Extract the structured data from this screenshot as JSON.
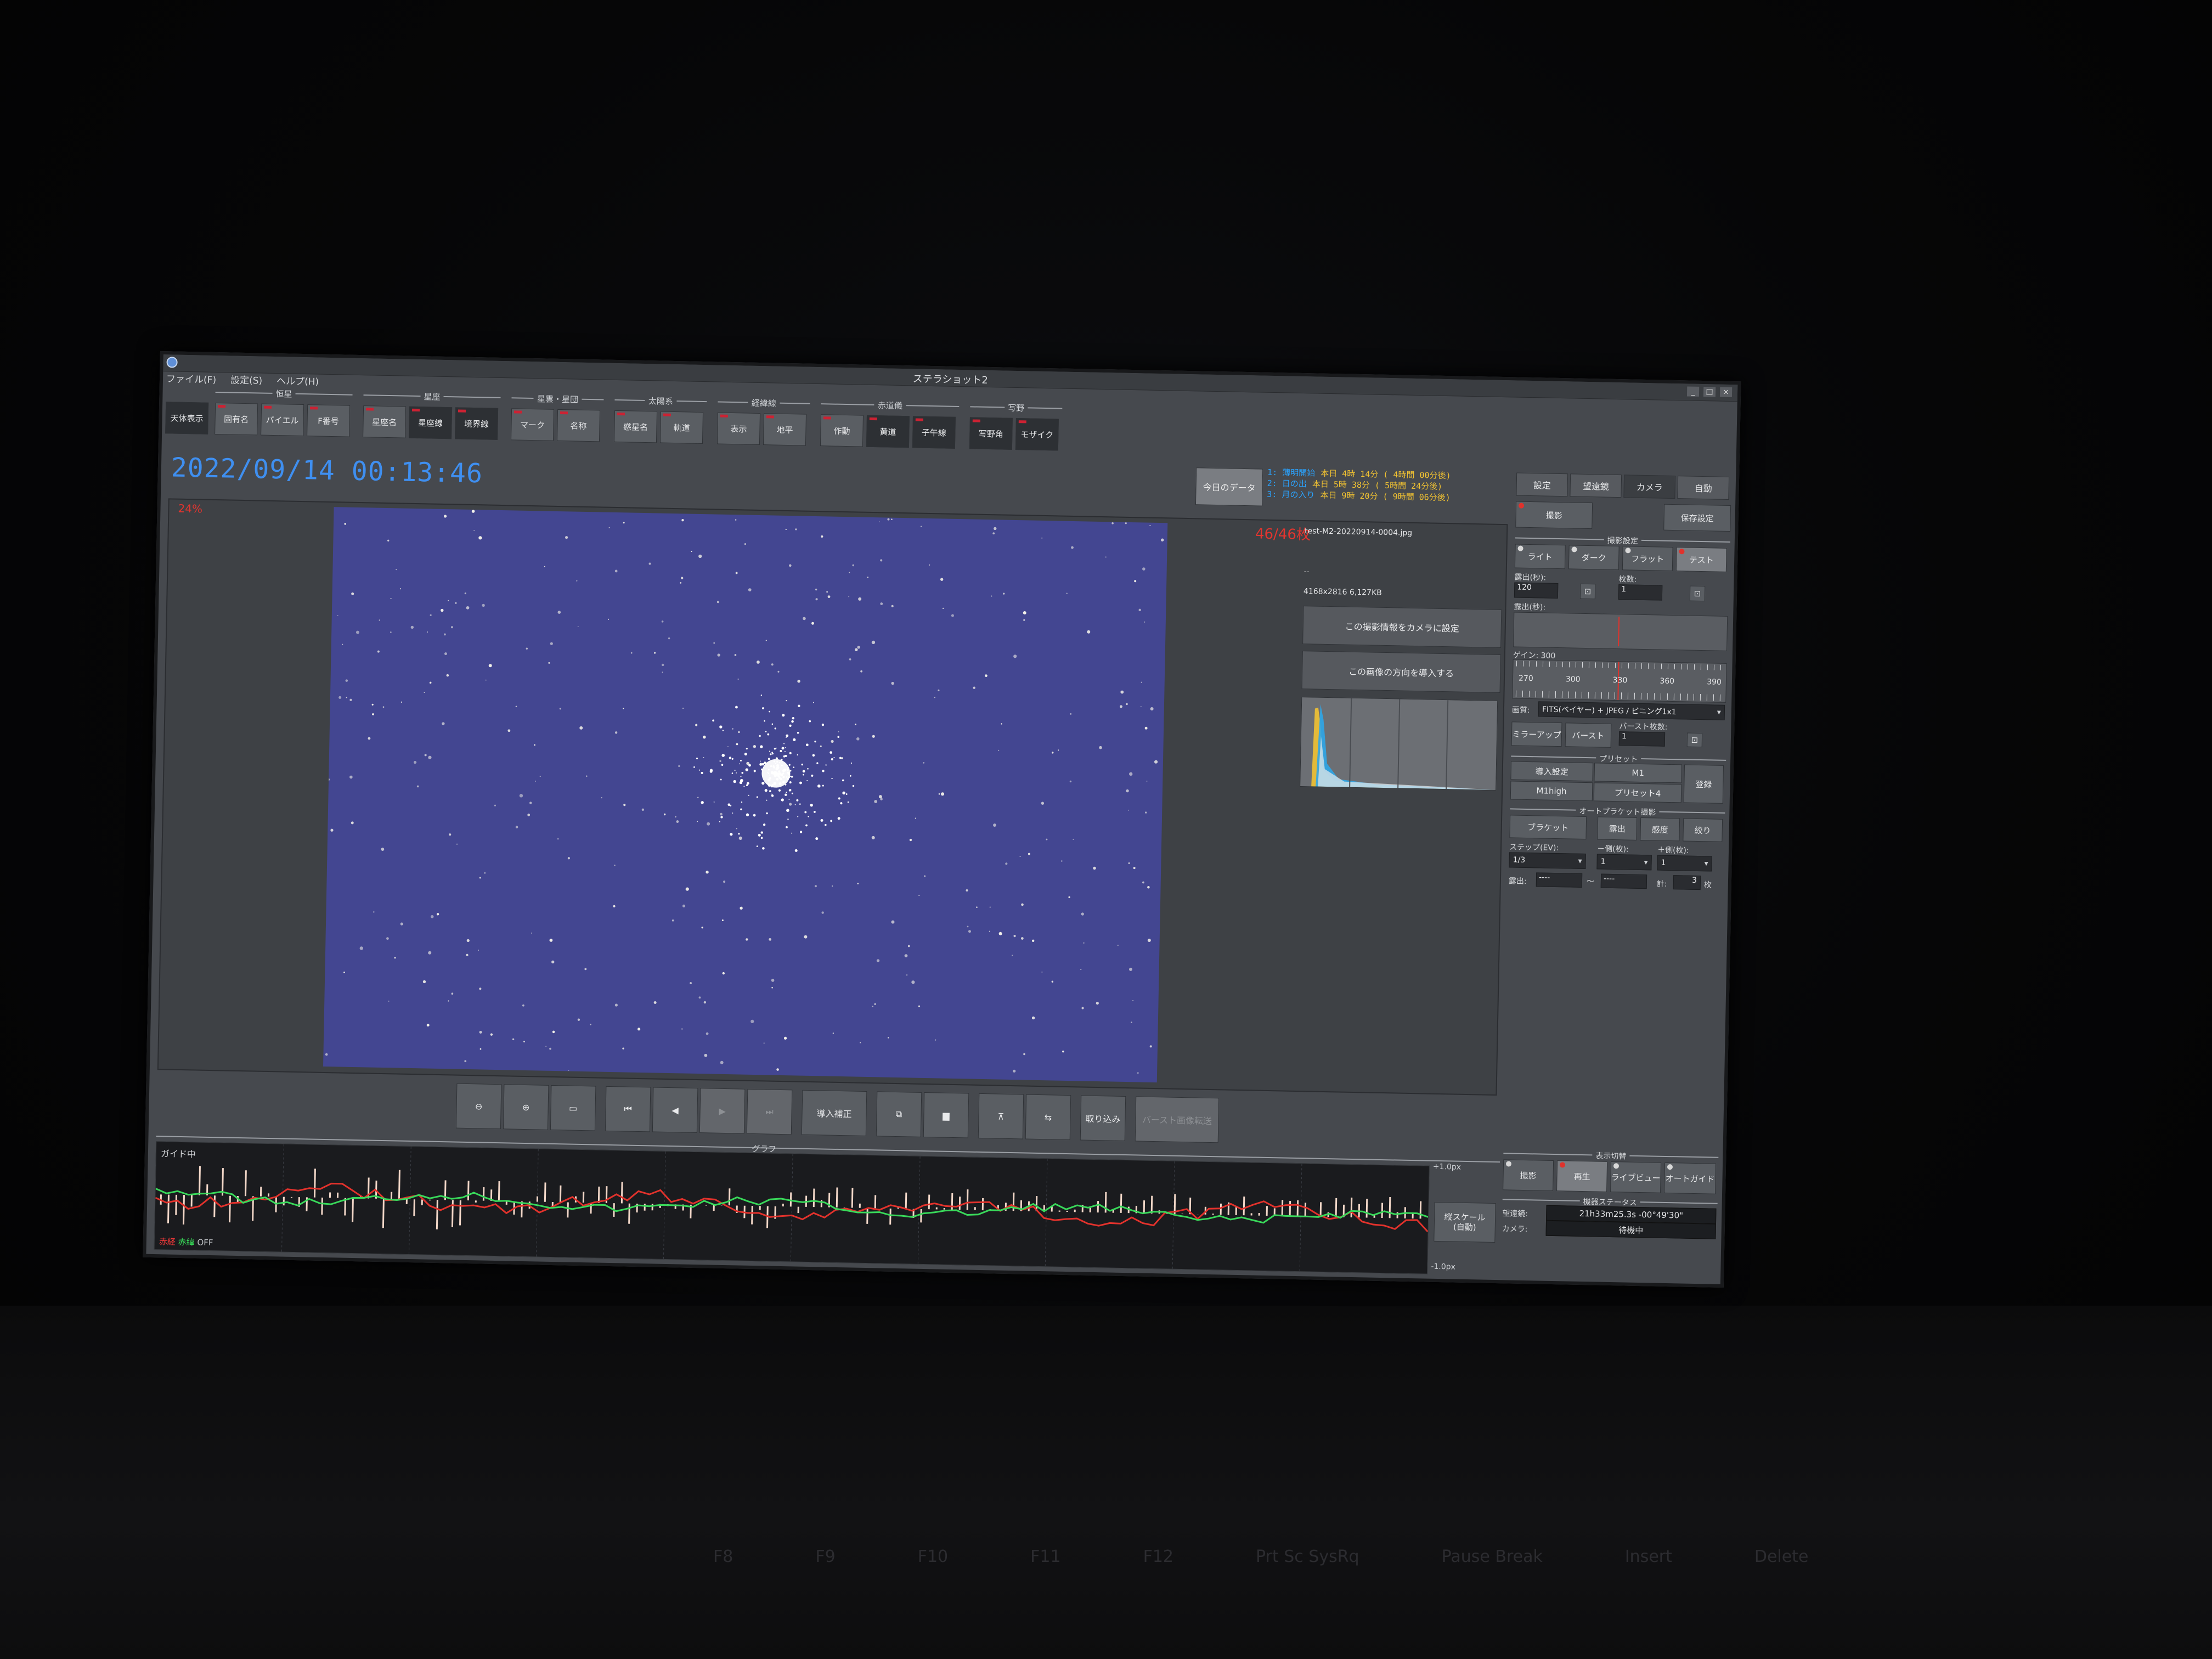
{
  "window": {
    "title": "ステラショット2",
    "controls": [
      "_",
      "□",
      "×"
    ]
  },
  "menu": [
    "ファイル(F)",
    "設定(S)",
    "ヘルプ(H)"
  ],
  "toolbar": {
    "first_button": "天体表示",
    "groups": [
      {
        "label": "恒星",
        "buttons": [
          "固有名",
          "バイエル",
          "F番号"
        ]
      },
      {
        "label": "星座",
        "buttons": [
          "星座名",
          "星座線",
          "境界線"
        ]
      },
      {
        "label": "星雲・星団",
        "buttons": [
          "マーク",
          "名称"
        ]
      },
      {
        "label": "太陽系",
        "buttons": [
          "惑星名",
          "軌道"
        ]
      },
      {
        "label": "経緯線",
        "buttons": [
          "表示",
          "地平"
        ]
      },
      {
        "label": "赤道儀",
        "buttons": [
          "作動",
          "黄道",
          "子午線"
        ]
      },
      {
        "label": "写野",
        "buttons": [
          "写野角",
          "モザイク"
        ]
      }
    ]
  },
  "datetime": "2022/09/14 00:13:46",
  "today_button": "今日のデータ",
  "events": [
    {
      "name": "1: 薄明開始",
      "value": "本日 4時 14分 ( 4時間 00分後)"
    },
    {
      "name": "2: 日の出",
      "value": "本日 5時 38分 ( 5時間 24分後)"
    },
    {
      "name": "3: 月の入り",
      "value": "本日 9時 20分 ( 9時間 06分後)"
    }
  ],
  "viewer": {
    "zoom": "24%",
    "counter": "46/46枚",
    "filename": "test-M2-20220914-0004.jpg",
    "dashes": "--",
    "image_info": "4168x2816 6,127KB",
    "set_info_button": "この撮影情報をカメラに設定",
    "direction_button": "この画像の方向を導入する"
  },
  "playbar": {
    "zoom_out": "zoom-out-icon",
    "zoom_in": "zoom-in-icon",
    "fit": "fit-icon",
    "first": "⏮",
    "prev": "◀",
    "play": "▶",
    "last": "⏭",
    "align": "導入補正",
    "import": "取り込み",
    "burst_transfer": "バースト画像転送"
  },
  "graph": {
    "title": "グラフ",
    "status": "ガイド中",
    "legend_ra": "赤経",
    "legend_dec": "赤緯",
    "legend_off": "OFF",
    "scale_top": "+1.0px",
    "scale_bottom": "-1.0px",
    "scale_button": "縦スケール\n(自動)"
  },
  "right_panel": {
    "tabs": [
      "設定",
      "望遠鏡",
      "カメラ",
      "自動"
    ],
    "shoot_button": "撮影",
    "save_settings_button": "保存設定",
    "shoot_settings_section": "撮影設定",
    "frame_types": [
      "ライト",
      "ダーク",
      "フラット",
      "テスト"
    ],
    "exposure_label": "露出(秒):",
    "exposure_value": "120",
    "count_label": "枚数:",
    "count_value": "1",
    "exposure_gauge_label": "露出(秒):",
    "gain_label": "ゲイン: 300",
    "gain_ticks": [
      "270",
      "300",
      "330",
      "360",
      "390"
    ],
    "image_label": "画質:",
    "image_value": "FITS(ベイヤー) + JPEG / ビニング1x1",
    "mirror_up": "ミラーアップ",
    "burst": "バースト",
    "burst_count_label": "バースト枚数:",
    "burst_count_value": "1",
    "preset_section": "プリセット",
    "presets": [
      "導入設定",
      "M1",
      "M1high",
      "プリセット4"
    ],
    "register_button": "登録",
    "auto_bracket_section": "オートブラケット撮影",
    "bracket_buttons": [
      "ブラケット",
      "露出",
      "感度",
      "絞り"
    ],
    "step_label": "ステップ(EV):",
    "minus_label": "－側(枚):",
    "plus_label": "＋側(枚):",
    "step_value": "1/3",
    "minus_value": "1",
    "plus_value": "1",
    "exposure_range_label": "露出:",
    "range_from": "----",
    "range_to": "----",
    "total_label": "計:",
    "total_value": "3",
    "total_unit": "枚",
    "display_section": "表示切替",
    "display_buttons": [
      "撮影",
      "再生",
      "ライブビュー",
      "オートガイド"
    ],
    "device_status_section": "機器ステータス",
    "telescope_label": "望遠鏡:",
    "telescope_value": "21h33m25.3s -00°49'30\"",
    "camera_label": "カメラ:",
    "camera_value": "待機中"
  },
  "keyboard_labels": [
    "F8",
    "F9",
    "F10",
    "F11",
    "F12",
    "Prt Sc SysRq",
    "Pause Break",
    "Insert",
    "Delete"
  ]
}
